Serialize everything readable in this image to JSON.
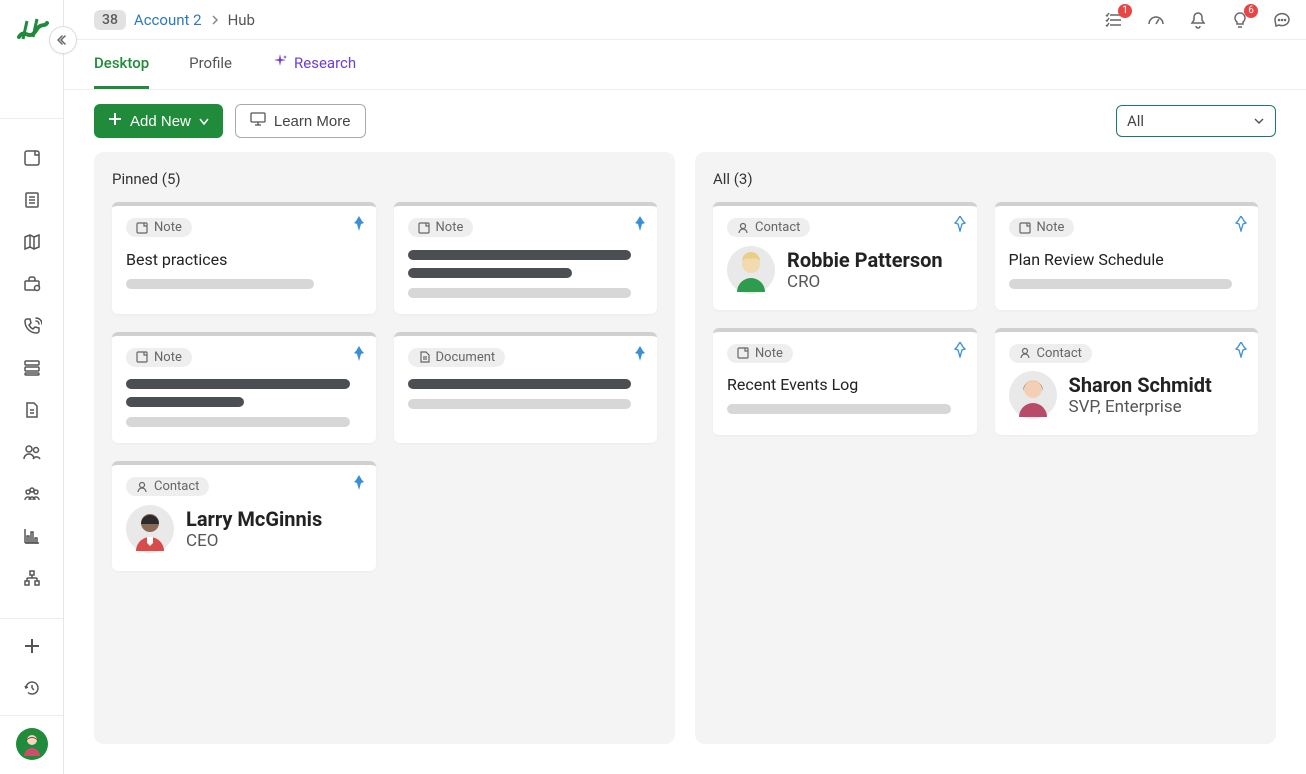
{
  "breadcrumb": {
    "badge": "38",
    "account": "Account 2",
    "page": "Hub"
  },
  "topbar": {
    "tasks_badge": "1",
    "tips_badge": "6"
  },
  "tabs": {
    "desktop": "Desktop",
    "profile": "Profile",
    "research": "Research"
  },
  "toolbar": {
    "add_new": "Add New",
    "learn_more": "Learn More"
  },
  "filter": {
    "selected": "All"
  },
  "pinned": {
    "header": "Pinned (5)",
    "labels": {
      "note": "Note",
      "document": "Document",
      "contact": "Contact"
    },
    "cards": {
      "c1": {
        "title": "Best practices"
      },
      "c5": {
        "name": "Larry McGinnis",
        "role": "CEO"
      }
    }
  },
  "all": {
    "header": "All (3)",
    "labels": {
      "note": "Note",
      "contact": "Contact"
    },
    "cards": {
      "a1": {
        "name": "Robbie Patterson",
        "role": "CRO"
      },
      "a2": {
        "title": "Plan Review Schedule"
      },
      "a3": {
        "title": "Recent Events Log"
      },
      "a4": {
        "name": "Sharon Schmidt",
        "role": "SVP, Enterprise"
      }
    }
  }
}
